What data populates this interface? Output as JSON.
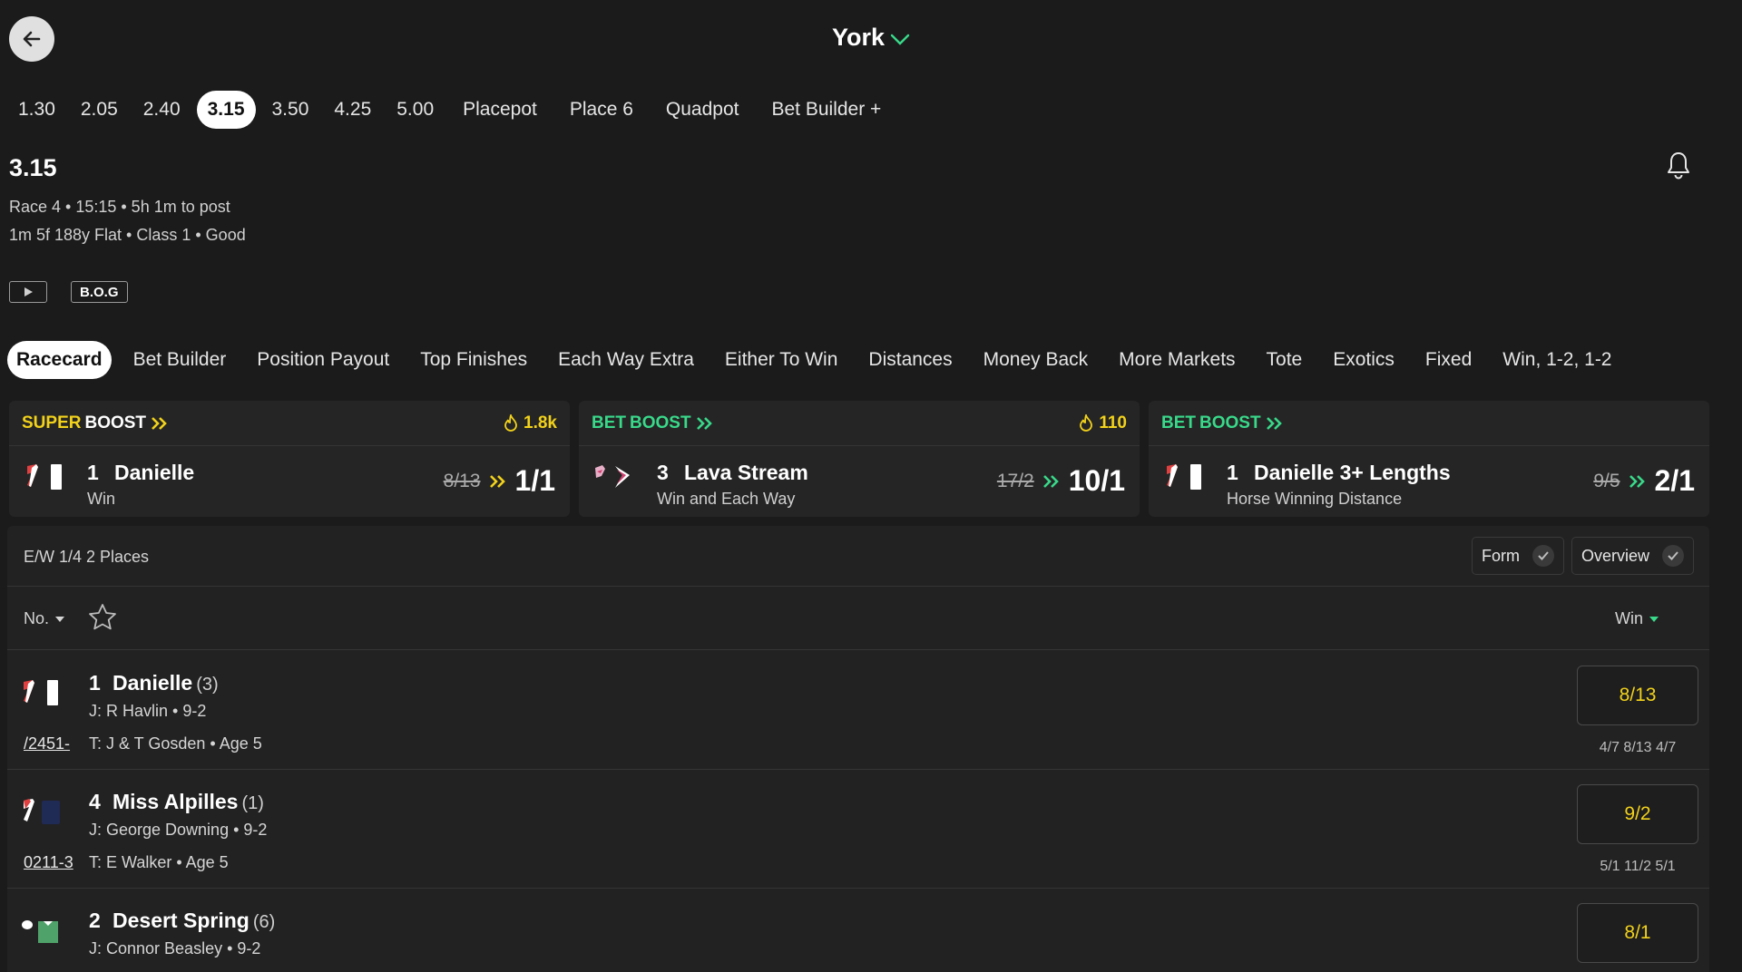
{
  "header": {
    "venue": "York"
  },
  "race_times": [
    "1.30",
    "2.05",
    "2.40",
    "3.15",
    "3.50",
    "4.25",
    "5.00",
    "Placepot",
    "Place 6",
    "Quadpot",
    "Bet Builder +"
  ],
  "race": {
    "title": "3.15",
    "line1": "Race 4 • 15:15 • 5h 1m to post",
    "line2": "1m 5f 188y Flat  • Class 1  • Good",
    "bog_label": "B.O.G"
  },
  "market_tabs": [
    "Racecard",
    "Bet Builder",
    "Position Payout",
    "Top Finishes",
    "Each Way Extra",
    "Either To Win",
    "Distances",
    "Money Back",
    "More Markets",
    "Tote",
    "Exotics",
    "Fixed",
    "Win, 1-2, 1-2"
  ],
  "boosts": [
    {
      "type_a": "SUPER",
      "type_b": "BOOST",
      "popularity": "1.8k",
      "number": "1",
      "name": "Danielle",
      "sub": "Win",
      "old_odds": "8/13",
      "new_odds": "1/1"
    },
    {
      "type_a": "BET",
      "type_b": "BOOST",
      "popularity": "110",
      "number": "3",
      "name": "Lava Stream",
      "sub": "Win and Each Way",
      "old_odds": "17/2",
      "new_odds": "10/1"
    },
    {
      "type_a": "BET",
      "type_b": "BOOST",
      "popularity": "",
      "number": "1",
      "name": "Danielle 3+ Lengths",
      "sub": "Horse Winning Distance",
      "old_odds": "9/5",
      "new_odds": "2/1"
    }
  ],
  "racecard": {
    "each_way": "E/W 1/4 2 Places",
    "form_toggle": "Form",
    "overview_toggle": "Overview",
    "sort_no": "No.",
    "sort_win": "Win",
    "runners": [
      {
        "number": "1",
        "name": "Danielle",
        "draw": "(3)",
        "jockey": "J: R Havlin • 9-2",
        "form": "/2451-",
        "trainer": "T: J & T Gosden • Age 5",
        "odds": "8/13",
        "history": "4/7  8/13  4/7"
      },
      {
        "number": "4",
        "name": "Miss Alpilles",
        "draw": "(1)",
        "jockey": "J: George Downing • 9-2",
        "form": "0211-3",
        "trainer": "T: E Walker • Age 5",
        "odds": "9/2",
        "history": "5/1  11/2  5/1"
      },
      {
        "number": "2",
        "name": "Desert Spring",
        "draw": "(6)",
        "jockey": "J: Connor Beasley • 9-2",
        "form": "",
        "trainer": "",
        "odds": "8/1",
        "history": ""
      }
    ]
  },
  "colors": {
    "background": "#1b1b1b",
    "panel": "#252525",
    "boost_yellow": "#f2d21b",
    "boost_green": "#39d98a",
    "odds_text": "#f2d21b"
  }
}
